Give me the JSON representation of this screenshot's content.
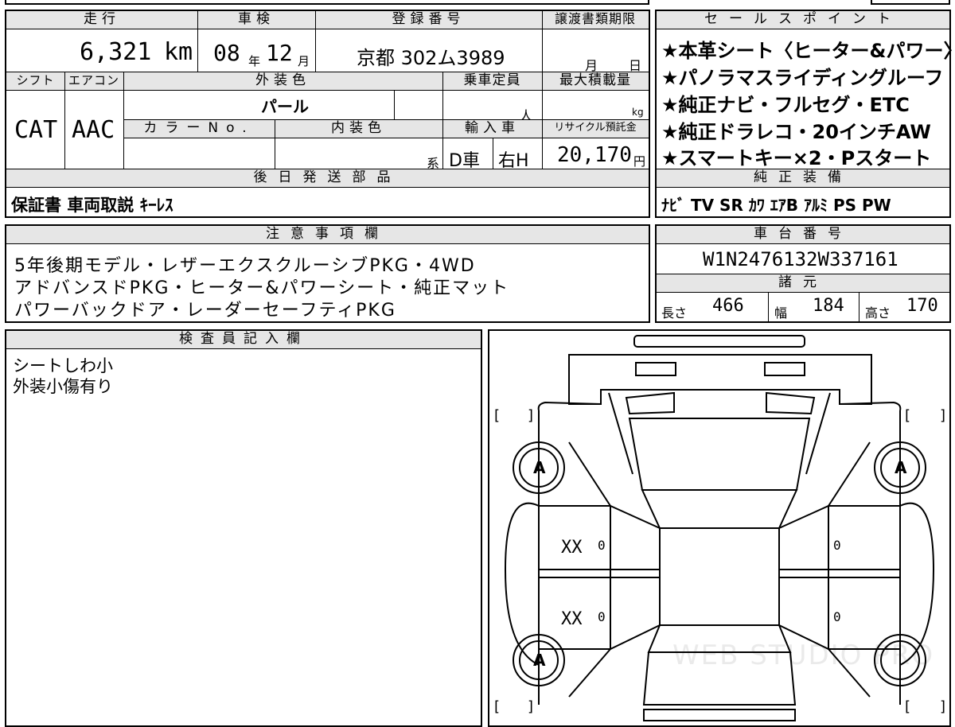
{
  "top_info": {
    "mileage_header": "走行",
    "mileage": "6,321",
    "mileage_unit": "km",
    "inspection_header": "車検",
    "inspection_year": "08",
    "inspection_year_unit": "年",
    "inspection_month": "12",
    "inspection_month_unit": "月",
    "registration_header": "登録番号",
    "registration": "京都 302ム3989",
    "transfer_header": "譲渡書類期限",
    "transfer_month_unit": "月",
    "transfer_day_unit": "日"
  },
  "spec_row": {
    "shift_header": "シフト",
    "shift": "CAT",
    "aircon_header": "エアコン",
    "aircon": "AAC",
    "exterior_color_header": "外装色",
    "exterior_color": "パール",
    "color_no_header": "カラーNo.",
    "interior_color_header": "内装色",
    "interior_suffix": "系",
    "capacity_header": "乗車定員",
    "capacity_unit": "人",
    "max_load_header": "最大積載量",
    "max_load_unit": "kg",
    "import_header": "輸入車",
    "import_type": "D車",
    "steering": "右H",
    "recycle_header": "リサイクル預託金",
    "recycle": "20,170",
    "recycle_unit": "円"
  },
  "later_parts": {
    "header": "後日発送部品",
    "value": "保証書 車両取説 ｷｰﾚｽ"
  },
  "sales_points": {
    "header": "セールスポイント",
    "lines": [
      "★本革シート〈ヒーター&パワー〉",
      "★パノラマスライディングルーフ",
      "★純正ナビ・フルセグ・ETC",
      "★純正ドラレコ・20インチAW",
      "★スマートキー×2・Pスタート"
    ]
  },
  "genuine_equipment": {
    "header": "純正装備",
    "value": "ﾅﾋﾞ TV SR ｶﾜ ｴｱB ｱﾙﾐ PS PW"
  },
  "notes": {
    "header": "注意事項欄",
    "lines": [
      "5年後期モデル・レザーエクスクルーシブPKG・4WD",
      "アドバンスドPKG・ヒーター&パワーシート・純正マット",
      "パワーバックドア・レーダーセーフティPKG"
    ]
  },
  "chassis": {
    "header": "車台番号",
    "value": "W1N2476132W337161"
  },
  "dimensions": {
    "header": "諸元",
    "length_label": "長さ",
    "length": "466",
    "width_label": "幅",
    "width": "184",
    "height_label": "高さ",
    "height": "170"
  },
  "inspector": {
    "header": "検査員記入欄",
    "lines": [
      "シートしわ小",
      "外装小傷有り"
    ]
  },
  "diagram": {
    "tire_front_left": "A",
    "tire_front_right": "A",
    "tire_rear_left": "A",
    "front_door_left_damage": "XX",
    "front_door_left_code": "0",
    "rear_door_left_damage": "XX",
    "rear_door_left_code": "0",
    "front_door_right_code": "0",
    "rear_door_right_code": "0",
    "watermark": "WEB STUDIO PRO"
  }
}
